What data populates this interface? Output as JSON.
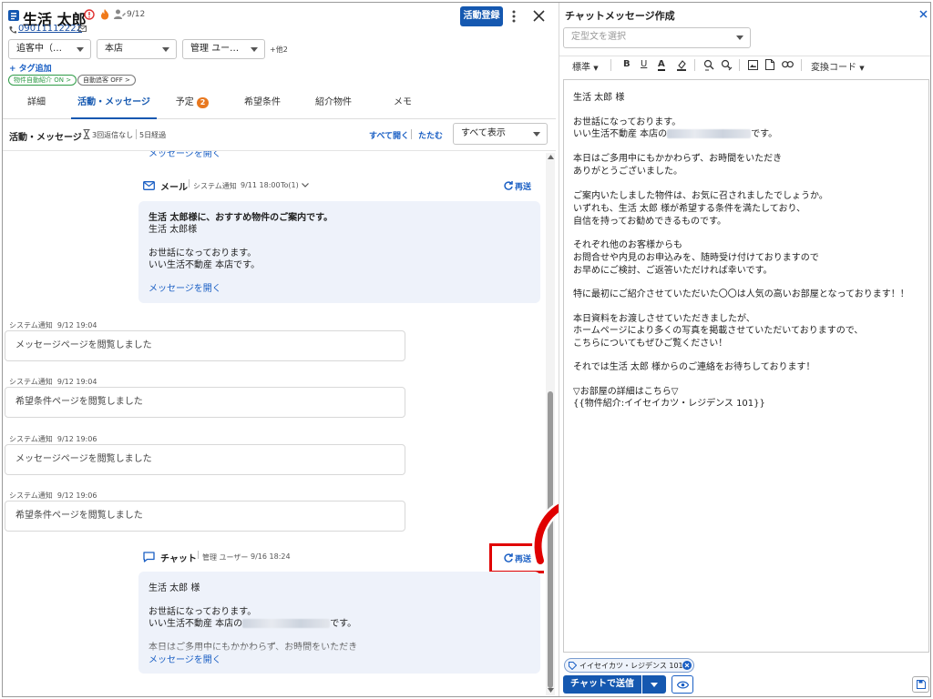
{
  "header": {
    "customer_name": "生活 太郎",
    "date": "9/12",
    "phone": "09011112222",
    "activity_button": "活動登録",
    "status_select": "追客中（…",
    "store_select": "本店",
    "manager_select": "管理 ユー…",
    "more_count": "+他2",
    "add_tag": "+ タグ追加",
    "pill_auto_intro": "物件自動紹介 ON",
    "pill_auto_follow": "自動追客 OFF"
  },
  "tabs": [
    {
      "label": "詳細"
    },
    {
      "label": "活動・メッセージ"
    },
    {
      "label": "予定",
      "badge": "2"
    },
    {
      "label": "希望条件"
    },
    {
      "label": "紹介物件"
    },
    {
      "label": "メモ"
    }
  ],
  "activity": {
    "heading": "活動・メッセージ",
    "no_reply": "3回返信なし",
    "elapsed": "5日経過",
    "expand_all": "すべて開く",
    "collapse": "たたむ",
    "filter_select": "すべて表示"
  },
  "mail_item": {
    "type": "メール",
    "sender": "システム通知",
    "datetime": "9/11 18:00",
    "to": "To(1)",
    "resend": "再送",
    "line1": "生活 太郎様に、おすすめ物件のご案内です。",
    "line2": "生活 太郎様",
    "line3": "お世話になっております。",
    "line4": "いい生活不動産 本店です。",
    "open_link": "メッセージを開く"
  },
  "notifications": [
    {
      "meta": "システム通知",
      "time": "9/12 19:04",
      "text": "メッセージページを閲覧しました"
    },
    {
      "meta": "システム通知",
      "time": "9/12 19:04",
      "text": "希望条件ページを閲覧しました"
    },
    {
      "meta": "システム通知",
      "time": "9/12 19:06",
      "text": "メッセージページを閲覧しました"
    },
    {
      "meta": "システム通知",
      "time": "9/12 19:06",
      "text": "希望条件ページを閲覧しました"
    }
  ],
  "chat_item": {
    "type": "チャット",
    "sender": "管理 ユーザー",
    "datetime": "9/16 18:24",
    "resend": "再送",
    "line1": "生活 太郎 様",
    "line2": "お世話になっております。",
    "line3": "いい生活不動産 本店の",
    "line3_end": "です。",
    "line4": "本日はご多用中にもかかわらず、お時間をいただき",
    "open_link": "メッセージを開く"
  },
  "compose": {
    "title": "チャットメッセージ作成",
    "template_placeholder": "定型文を選択",
    "style_select": "標準",
    "convert_code": "変換コード",
    "body_lines": [
      "生活 太郎 様",
      "",
      "お世話になっております。",
      "いい生活不動産 本店の",
      "",
      "本日はご多用中にもかかわらず、お時間をいただき",
      "ありがとうございました。",
      "",
      "ご案内いたしました物件は、お気に召されましたでしょうか。",
      "いずれも、生活 太郎 様が希望する条件を満たしており、",
      "自信を持ってお勧めできるものです。",
      "",
      "それぞれ他のお客様からも",
      "お問合せや内見のお申込みを、随時受け付けておりますので",
      "お早めにご検討、ご返答いただければ幸いです。",
      "",
      "特に最初にご紹介させていただいた〇〇は人気の高いお部屋となっております！！",
      "",
      "本日資料をお渡しさせていただきましたが、",
      "ホームページにより多くの写真を掲載させていただいておりますので、",
      "こちらについてもぜひご覧ください！",
      "",
      "それでは生活 太郎 様からのご連絡をお待ちしております！",
      "",
      "▽お部屋の詳細はこちら▽",
      "{{物件紹介:イイセイカツ・レジデンス 101}}"
    ],
    "line4_suffix": "です。",
    "attachment_tag": "イイセイカツ・レジデンス 101",
    "send_button": "チャットで送信"
  },
  "colors": {
    "accent": "#1558b0",
    "highlight_box": "#e00000",
    "card_bg": "#eef2fa",
    "badge": "#e8781f",
    "pill_green": "#2e9b46"
  }
}
